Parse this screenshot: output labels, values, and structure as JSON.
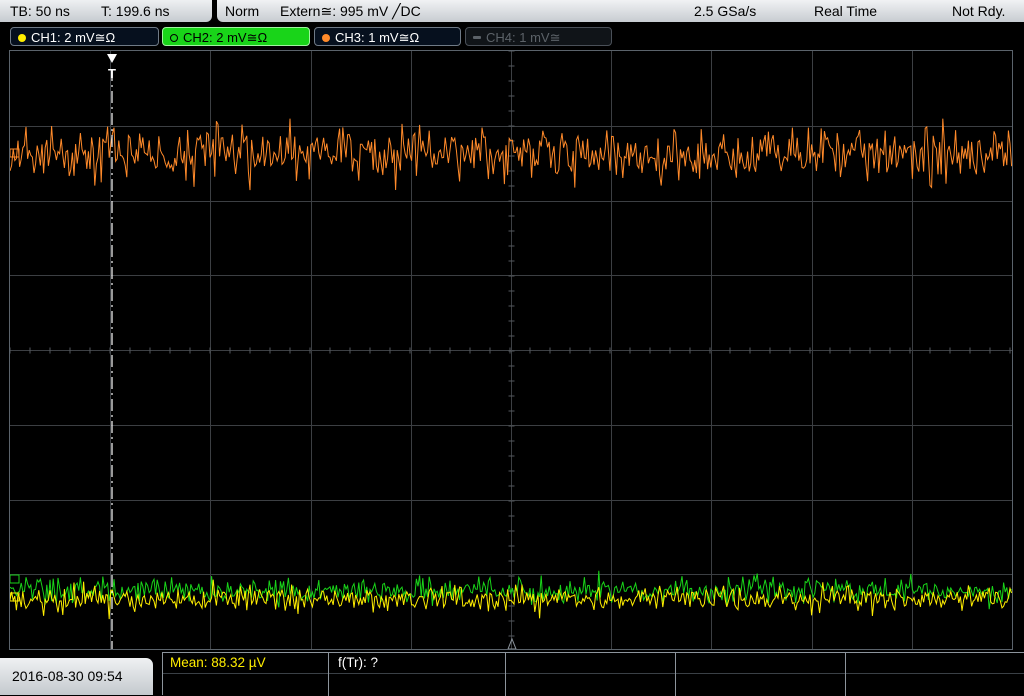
{
  "top_bar": {
    "timebase": "TB: 50 ns",
    "trigger_time": "T: 199.6 ns",
    "mode": "Norm",
    "trigger_source": "Extern≅: 995 mV ╱DC",
    "sample_rate": "2.5 GSa/s",
    "acquisition": "Real Time",
    "status": "Not Rdy."
  },
  "channels": [
    {
      "label": "CH1: 2 mV≅Ω",
      "color": "#ffee00",
      "active": false
    },
    {
      "label": "CH2: 2 mV≅Ω",
      "color": "#19d419",
      "active": true
    },
    {
      "label": "CH3: 1 mV≅Ω",
      "color": "#ff8a2a",
      "active": false
    },
    {
      "label": "CH4: 1 mV≅",
      "color": "#5c6268",
      "enabled": false
    }
  ],
  "trigger_marker": "T",
  "bottom": {
    "datetime": "2016-08-30 09:54",
    "measurements": [
      {
        "label": "Mean: 88.32 µV",
        "color": "#ffee00"
      },
      {
        "label": "f(Tr): ?",
        "color": "#ffffff"
      }
    ]
  },
  "colors": {
    "ch1": "#ffee00",
    "ch2": "#19d419",
    "ch3": "#ff8a2a",
    "grid": "#3c3f43",
    "background": "#000000"
  }
}
